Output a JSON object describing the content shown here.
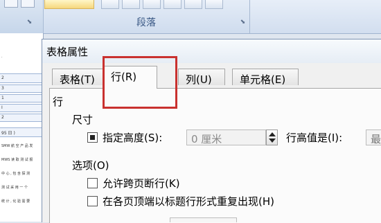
{
  "ribbon": {
    "group_label": "段落"
  },
  "document": {
    "cells": [
      "2",
      "3",
      "1",
      "I",
      "2"
    ],
    "date_row": "95 日 )",
    "text_lines": [
      "SMW 航 空 产 品 发",
      "MWS 读 取 测 试 报",
      "中 心 , 包 含 探 测",
      "测 试 采 用 一 个",
      "统 计 , 化 验 需 要"
    ]
  },
  "dialog": {
    "title": "表格属性",
    "tabs": [
      {
        "label": "表格(T)",
        "active": false
      },
      {
        "label": "行(R)",
        "active": true
      },
      {
        "label": "列(U)",
        "active": false
      },
      {
        "label": "单元格(E)",
        "active": false
      }
    ],
    "row_section": {
      "header": "行",
      "size_label": "尺寸",
      "specify_height": {
        "label": "指定高度(S):",
        "checked": true
      },
      "height_value": "0 厘米",
      "row_height_is_label": "行高值是(I):",
      "row_height_is_value": "最"
    },
    "options": {
      "header": "选项(O)",
      "allow_break": {
        "label": "允许跨页断行(K)",
        "checked": false
      },
      "repeat_header": {
        "label": "在各页顶端以标题行形式重复出现(H)",
        "checked": false
      }
    }
  },
  "annotation": {
    "highlight_color": "#c9312f"
  }
}
